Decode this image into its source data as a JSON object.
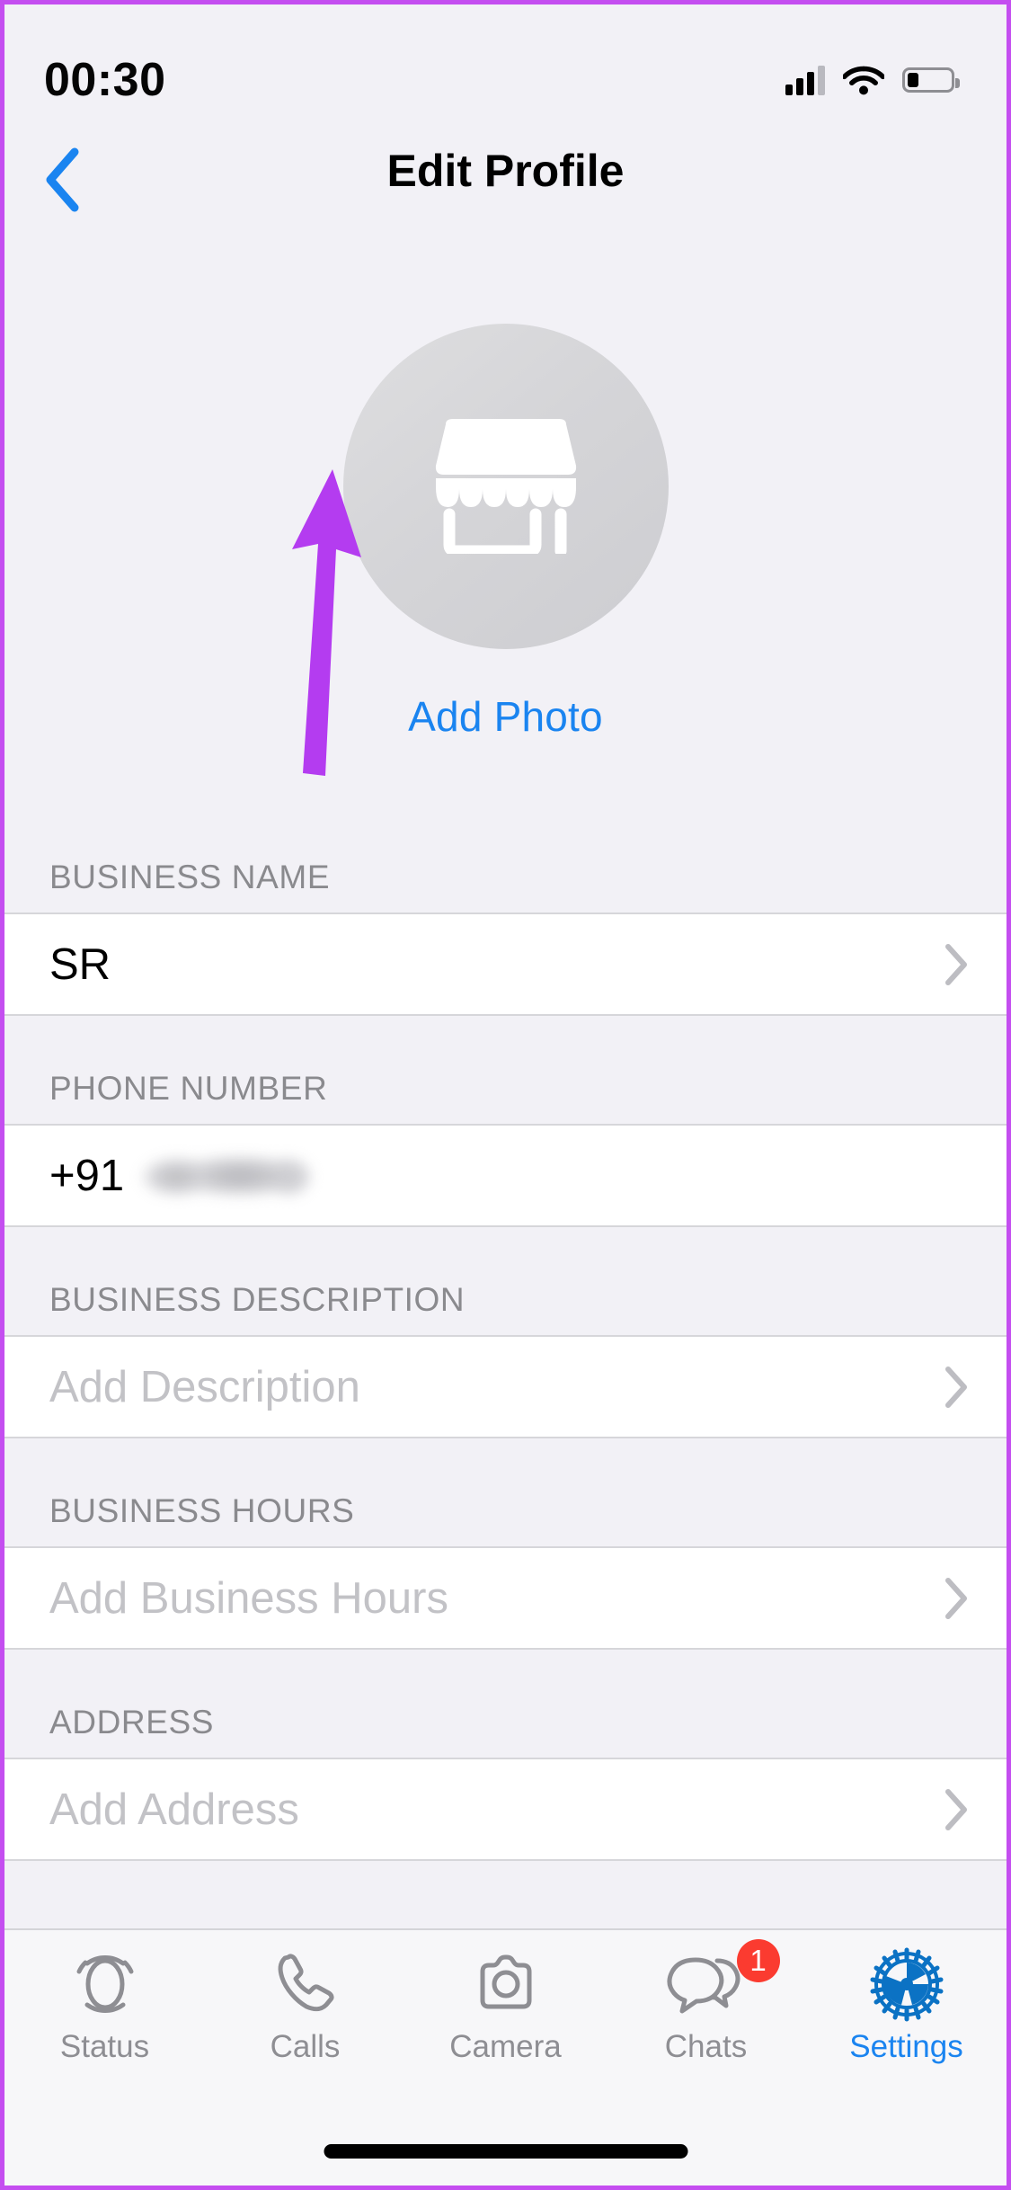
{
  "status_bar": {
    "time": "00:30",
    "signal_icon": "cellular-signal-icon",
    "wifi_icon": "wifi-icon",
    "battery_icon": "battery-low-icon"
  },
  "nav": {
    "back_icon": "chevron-left-icon",
    "title": "Edit Profile"
  },
  "profile": {
    "avatar_icon": "storefront-icon",
    "add_photo_label": "Add Photo"
  },
  "sections": [
    {
      "header": "BUSINESS NAME",
      "value": "SR",
      "is_placeholder": false,
      "chevron_icon": "chevron-right-icon"
    },
    {
      "header": "PHONE NUMBER",
      "value": "+91",
      "redacted": true,
      "is_placeholder": false,
      "chevron_icon": ""
    },
    {
      "header": "BUSINESS DESCRIPTION",
      "value": "Add Description",
      "is_placeholder": true,
      "chevron_icon": "chevron-right-icon"
    },
    {
      "header": "BUSINESS HOURS",
      "value": "Add Business Hours",
      "is_placeholder": true,
      "chevron_icon": "chevron-right-icon"
    },
    {
      "header": "ADDRESS",
      "value": "Add Address",
      "is_placeholder": true,
      "chevron_icon": "chevron-right-icon"
    }
  ],
  "tabbar": {
    "items": [
      {
        "label": "Status",
        "icon": "status-rings-icon",
        "active": false,
        "badge": ""
      },
      {
        "label": "Calls",
        "icon": "phone-icon",
        "active": false,
        "badge": ""
      },
      {
        "label": "Camera",
        "icon": "camera-icon",
        "active": false,
        "badge": ""
      },
      {
        "label": "Chats",
        "icon": "chat-bubbles-icon",
        "active": false,
        "badge": "1"
      },
      {
        "label": "Settings",
        "icon": "gear-icon",
        "active": true,
        "badge": ""
      }
    ]
  },
  "annotation": {
    "arrow_icon": "arrow-up-annotation",
    "color": "#b43cf0"
  },
  "colors": {
    "accent_blue": "#1a84f0",
    "background": "#f2f1f6",
    "row_background": "#ffffff",
    "badge_red": "#fb3b30",
    "annotation_purple": "#b43cf0",
    "border_purple": "#c44ef0"
  }
}
